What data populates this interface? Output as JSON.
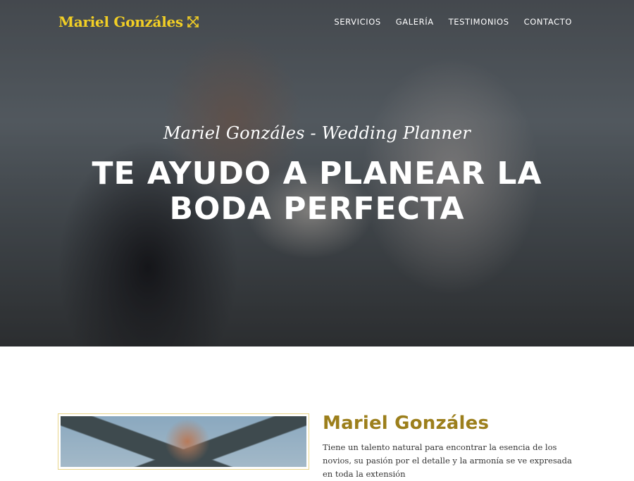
{
  "brand": {
    "name": "Mariel Gonzáles",
    "icon": "crossed-arrows-icon",
    "color": "#f2cf25"
  },
  "nav": {
    "items": [
      {
        "label": "SERVICIOS"
      },
      {
        "label": "GALERÍA"
      },
      {
        "label": "TESTIMONIOS"
      },
      {
        "label": "CONTACTO"
      }
    ]
  },
  "hero": {
    "subtitle": "Mariel Gonzáles - Wedding Planner",
    "title_line1": "TE AYUDO A PLANEAR LA",
    "title_line2": "BODA PERFECTA"
  },
  "about": {
    "name": "Mariel Gonzáles",
    "text": "Tiene un talento natural para encontrar la esencia de los novios, su pasión por el detalle y la armonía se ve expresada en toda la extensión"
  },
  "colors": {
    "accent": "#9c7f1c",
    "frame": "#e7d58a"
  }
}
